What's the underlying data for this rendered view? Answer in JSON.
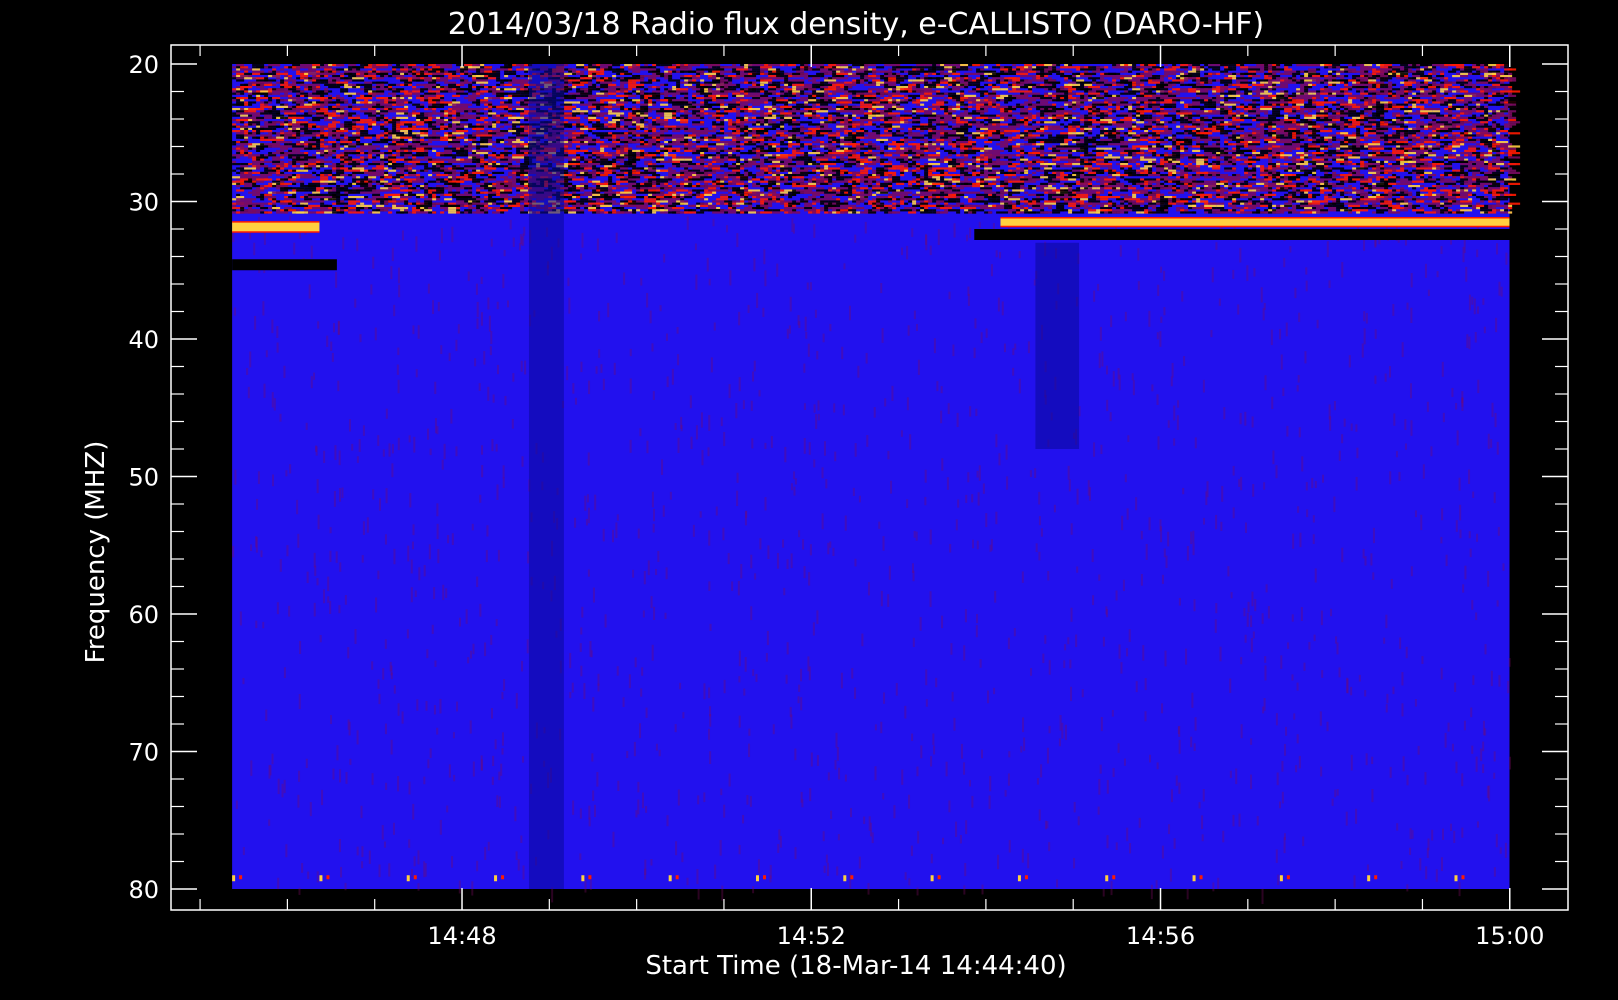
{
  "chart_data": {
    "type": "heatmap",
    "title": "2014/03/18  Radio flux density, e-CALLISTO (DARO-HF)",
    "xlabel": "Start Time (18-Mar-14 14:44:40)",
    "ylabel": "Frequency (MHZ)",
    "x_unit": "minutes past 14:44:40",
    "xlim": [
      0,
      16
    ],
    "ylim": [
      80,
      20
    ],
    "x_major_ticks": [
      {
        "value": 3.333,
        "label": "14:48"
      },
      {
        "value": 7.333,
        "label": "14:52"
      },
      {
        "value": 11.333,
        "label": "14:56"
      },
      {
        "value": 15.333,
        "label": "15:00"
      }
    ],
    "y_major_ticks": [
      {
        "value": 20,
        "label": "20"
      },
      {
        "value": 30,
        "label": "30"
      },
      {
        "value": 40,
        "label": "40"
      },
      {
        "value": 50,
        "label": "50"
      },
      {
        "value": 60,
        "label": "60"
      },
      {
        "value": 70,
        "label": "70"
      },
      {
        "value": 80,
        "label": "80"
      }
    ],
    "data_time_range": [
      0.7,
      15.33
    ],
    "data_freq_range": [
      20,
      80
    ],
    "colormap": [
      "#000000",
      "#1a00ff",
      "#7a0a60",
      "#ff1a00",
      "#ffd040",
      "#ffffc0"
    ],
    "background_color": "#2211ee",
    "features": [
      {
        "kind": "bright_band",
        "t": [
          9.5,
          15.33
        ],
        "f": [
          31.2,
          31.8
        ]
      },
      {
        "kind": "dark_band",
        "t": [
          9.2,
          15.33
        ],
        "f": [
          32.0,
          32.8
        ]
      },
      {
        "kind": "bright_band",
        "t": [
          0.7,
          1.7
        ],
        "f": [
          31.5,
          32.2
        ]
      },
      {
        "kind": "dark_band",
        "t": [
          0.7,
          1.9
        ],
        "f": [
          34.2,
          35.0
        ]
      },
      {
        "kind": "dark_column",
        "t": [
          4.1,
          4.5
        ],
        "f": [
          20,
          80
        ]
      },
      {
        "kind": "dark_column",
        "t": [
          9.9,
          10.4
        ],
        "f": [
          33,
          48
        ]
      }
    ]
  }
}
